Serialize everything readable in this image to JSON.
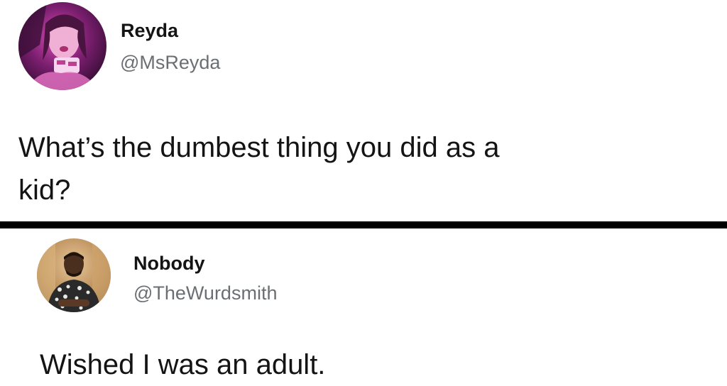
{
  "tweets": [
    {
      "display_name": "Reyda",
      "handle": "@MsReyda",
      "text": "What’s the dumbest thing you did as a\nkid?",
      "avatar_icon": "profile-photo-woman-purple-light"
    },
    {
      "display_name": "Nobody",
      "handle": "@TheWurdsmith",
      "text": "Wished I was an adult.",
      "avatar_icon": "profile-photo-man-patterned-shirt"
    }
  ],
  "divider_color": "#000000",
  "handle_color": "#6b6f73",
  "text_color": "#141414"
}
